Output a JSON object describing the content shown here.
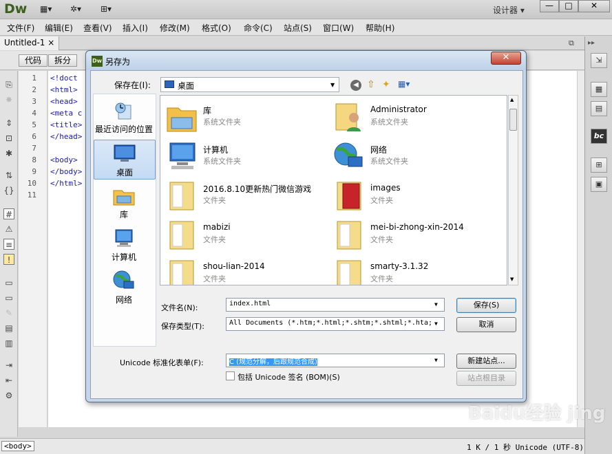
{
  "app": {
    "logo": "Dw",
    "workspace": "设计器",
    "tb_icons": [
      "layout-icon",
      "gear-icon",
      "site-icon"
    ]
  },
  "menu": [
    "文件(F)",
    "编辑(E)",
    "查看(V)",
    "插入(I)",
    "修改(M)",
    "格式(O)",
    "命令(C)",
    "站点(S)",
    "窗口(W)",
    "帮助(H)"
  ],
  "document": {
    "tab": "Untitled-1",
    "view_buttons": [
      "代码",
      "拆分"
    ],
    "line_numbers": [
      "1",
      "2",
      "3",
      "4",
      "5",
      "6",
      "7",
      "8",
      "9",
      "10",
      "11"
    ],
    "code_lines": [
      "<!doct",
      "<html>",
      "<head>",
      "<meta c",
      "<title>",
      "</head>",
      "",
      "<body>",
      "</body>",
      "</html>",
      ""
    ]
  },
  "status": {
    "tag": "<body>",
    "info": "1 K / 1 秒 Unicode (UTF-8)"
  },
  "dialog": {
    "title": "另存为",
    "save_in_label": "保存在(I):",
    "save_in_value": "桌面",
    "places": [
      {
        "label": "最近访问的位置",
        "icon": "recent-icon"
      },
      {
        "label": "桌面",
        "icon": "desktop-icon"
      },
      {
        "label": "库",
        "icon": "library-icon"
      },
      {
        "label": "计算机",
        "icon": "computer-icon"
      },
      {
        "label": "网络",
        "icon": "network-icon"
      }
    ],
    "files": [
      {
        "name": "库",
        "type": "系统文件夹",
        "icon": "library-icon"
      },
      {
        "name": "Administrator",
        "type": "系统文件夹",
        "icon": "user-folder-icon"
      },
      {
        "name": "计算机",
        "type": "系统文件夹",
        "icon": "computer-icon"
      },
      {
        "name": "网络",
        "type": "系统文件夹",
        "icon": "network-icon"
      },
      {
        "name": "2016.8.10更新热门微信游戏",
        "type": "文件夹",
        "icon": "folder-icon"
      },
      {
        "name": "images",
        "type": "文件夹",
        "icon": "folder-icon"
      },
      {
        "name": "mabizi",
        "type": "文件夹",
        "icon": "folder-icon"
      },
      {
        "name": "mei-bi-zhong-xin-2014",
        "type": "文件夹",
        "icon": "folder-icon"
      },
      {
        "name": "shou-lian-2014",
        "type": "文件夹",
        "icon": "folder-icon"
      },
      {
        "name": "smarty-3.1.32",
        "type": "文件夹",
        "icon": "folder-icon"
      }
    ],
    "filename_label": "文件名(N):",
    "filename_value": "index.html",
    "filetype_label": "保存类型(T):",
    "filetype_value": "All Documents (*.htm;*.html;*.shtm;*.shtml;*.hta;",
    "unicode_label": "Unicode 标准化表单(F):",
    "unicode_value": "C (规范分解，后跟规范合成)",
    "bom_label": "包括 Unicode 签名 (BOM)(S)",
    "save_button": "保存(S)",
    "cancel_button": "取消",
    "new_site_button": "新建站点...",
    "site_root_button": "站点根目录"
  },
  "watermark": "Baidu经验 jingyan.baidu.com"
}
